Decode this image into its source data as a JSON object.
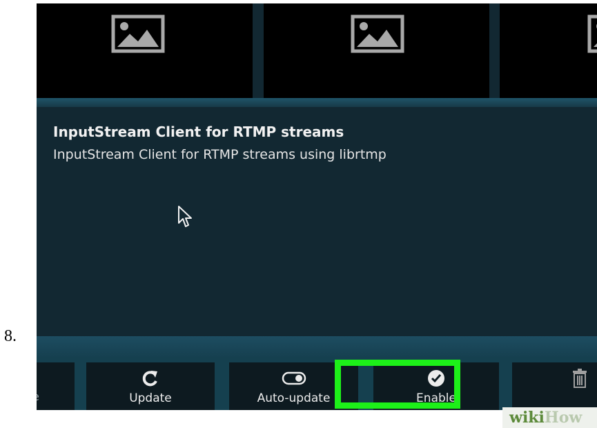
{
  "step": {
    "number": "8."
  },
  "addon": {
    "title": "InputStream Client for RTMP streams",
    "description": "InputStream Client for RTMP streams using librtmp"
  },
  "thumbnails": [
    {
      "icon": "image-placeholder-icon"
    },
    {
      "icon": "image-placeholder-icon"
    },
    {
      "icon": "image-placeholder-icon"
    }
  ],
  "buttons": {
    "partial_left_label": "e",
    "update": {
      "label": "Update",
      "icon": "refresh-icon"
    },
    "autoupdate": {
      "label": "Auto-update",
      "icon": "toggle-icon"
    },
    "enable": {
      "label": "Enable",
      "icon": "check-circle-icon"
    },
    "uninstall": {
      "icon": "trash-icon"
    }
  },
  "watermark": {
    "wiki": "wiki",
    "how": "How"
  },
  "colors": {
    "highlight": "#1df019",
    "background": "#122832",
    "button": "#0d1a20"
  }
}
